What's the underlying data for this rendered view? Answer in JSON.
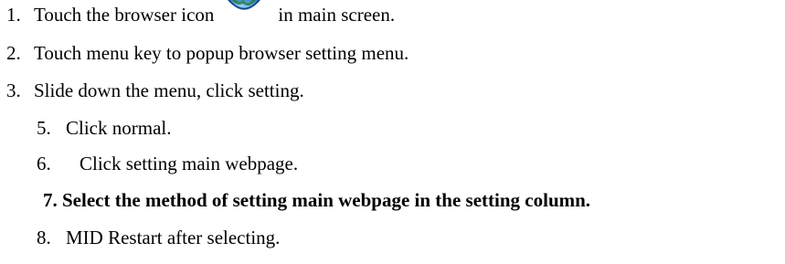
{
  "steps": [
    {
      "number": "1.",
      "text_before": "Touch the browser icon",
      "icon": "browser-globe-icon",
      "text_after": "in main screen."
    },
    {
      "number": "2.",
      "text": "Touch menu key to popup browser setting menu."
    },
    {
      "number": "3.",
      "text": "Slide down the menu, click setting."
    },
    {
      "number": "5.",
      "text": "Click normal."
    },
    {
      "number": "6.",
      "text": "Click setting main webpage."
    },
    {
      "number": "7.",
      "text": "Select the method of setting main webpage in the setting column."
    },
    {
      "number": "8.",
      "text": "MID Restart after selecting."
    }
  ],
  "colors": {
    "text": "#000000",
    "background": "#ffffff",
    "icon_blue_dark": "#1b5fa8",
    "icon_blue_light": "#6fb6ea"
  }
}
